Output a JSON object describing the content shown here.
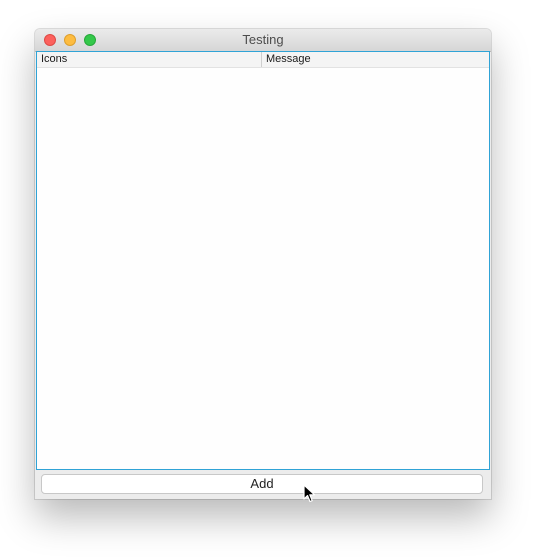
{
  "window": {
    "title": "Testing"
  },
  "table": {
    "columns": [
      "Icons",
      "Message"
    ],
    "rows": []
  },
  "actions": {
    "add_label": "Add"
  },
  "icons": {
    "close": "close-window-icon",
    "minimize": "minimize-window-icon",
    "maximize": "zoom-window-icon",
    "cursor": "mouse-pointer-icon"
  },
  "colors": {
    "focus_border": "#2fa3d6",
    "close": "#fc615d",
    "minimize": "#fdbc40",
    "maximize": "#34c84a"
  }
}
